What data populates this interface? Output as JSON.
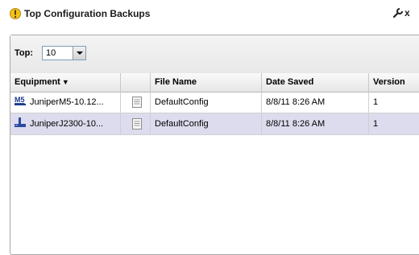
{
  "header": {
    "title": "Top Configuration Backups",
    "close_glyph": "x"
  },
  "toolbar": {
    "top_label": "Top:",
    "top_value": "10"
  },
  "table": {
    "columns": [
      {
        "label": "Equipment",
        "sort": "descending"
      },
      {
        "label": ""
      },
      {
        "label": "File Name"
      },
      {
        "label": "Date Saved"
      },
      {
        "label": "Version"
      }
    ],
    "rows": [
      {
        "equipment": "JuniperM5-10.12...",
        "equipment_icon": "router-m5-icon",
        "icon_text": "M5",
        "file_name": "DefaultConfig",
        "date_saved": "8/8/11 8:26 AM",
        "version": "1"
      },
      {
        "equipment": "JuniperJ2300-10...",
        "equipment_icon": "router-j2300-icon",
        "file_name": "DefaultConfig",
        "date_saved": "8/8/11 8:26 AM",
        "version": "1"
      }
    ]
  },
  "colors": {
    "selected_row": "#dcdcee",
    "m5_icon": "#1b3a8c",
    "j2300_icon": "#2a4aa0",
    "title_icon": "#f2c21b"
  }
}
